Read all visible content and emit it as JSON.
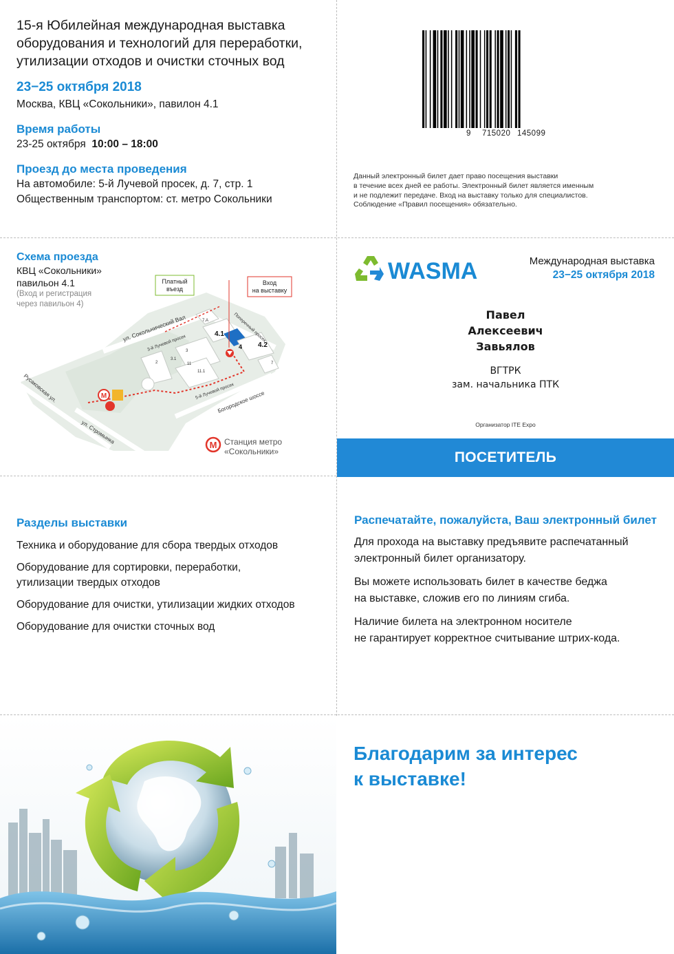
{
  "event": {
    "title_lines": [
      "15-я Юбилейная международная выставка",
      "оборудования и технологий для переработки,",
      "утилизации отходов и очистки сточных вод"
    ],
    "dates": "23−25 октября 2018",
    "venue": "Москва, КВЦ «Сокольники», павилон 4.1",
    "hours_heading": "Время работы",
    "hours_dates": "23-25 октября",
    "hours_time": "10:00 – 18:00",
    "travel_heading": "Проезд до места проведения",
    "by_car": "На автомобиле: 5-й Лучевой просек, д. 7, стр. 1",
    "by_transit": "Общественным транспортом: ст. метро Сокольники"
  },
  "barcode": {
    "digits": [
      "9",
      "715020",
      "145099"
    ]
  },
  "notice_lines": [
    "Данный электронный билет дает право посещения выставки",
    "в течение всех дней ее работы. Электронный билет является именным",
    "и не подлежит передаче. Вход на выставку только для специалистов.",
    "Соблюдение «Правил посещения» обязательно."
  ],
  "map": {
    "heading": "Схема проезда",
    "venue_line1": "КВЦ «Сокольники»",
    "venue_line2": "павильон 4.1",
    "note_line1": "(Вход и регистрация",
    "note_line2": "через павильон 4)",
    "paid_entry_line1": "Платный",
    "paid_entry_line2": "въезд",
    "entrance_line1": "Вход",
    "entrance_line2": "на выставку",
    "metro_line1": "Станция метро",
    "metro_line2": "«Сокольники»",
    "streets": {
      "sokolnichesky_val": "ул. Сокольнический Вал",
      "luchevoy3": "3-й Лучевой просек",
      "poperechny": "Поперечный просек",
      "luchevoy5": "5-й Лучевой просек",
      "bogorodskoe": "Богородское шоссе",
      "rusakovskaya": "Русаковская ул.",
      "stromynka": "ул. Стромынка"
    },
    "buildings": [
      "7.А",
      "4.1",
      "4",
      "4.2",
      "3",
      "3.1",
      "2",
      "11",
      "11.1",
      "7"
    ]
  },
  "badge": {
    "logo_text": "WASMA",
    "exhibition_label": "Международная выставка",
    "dates": "23−25 октября 2018",
    "first_name": "Павел",
    "patronymic": "Алексеевич",
    "last_name": "Завьялов",
    "company": "ВГТРК",
    "position": "зам. начальника ПТК",
    "organizer": "Организатор ITE Expo",
    "role": "ПОСЕТИТЕЛЬ"
  },
  "sections": {
    "heading": "Разделы выставки",
    "items": [
      [
        "Техника и оборудование для сбора твердых отходов"
      ],
      [
        "Оборудование для сортировки, переработки,",
        "утилизации твердых отходов"
      ],
      [
        "Оборудование для очистки, утилизации жидких отходов"
      ],
      [
        "Оборудование для очистки сточных вод"
      ]
    ]
  },
  "print_info": {
    "heading": "Распечатайте, пожалуйста, Ваш электронный билет",
    "paragraphs": [
      [
        "Для прохода на выставку предъявите распечатанный",
        "электронный билет организатору."
      ],
      [
        "Вы можете использовать билет в качестве беджа",
        "на выставке, сложив его по линиям сгиба."
      ],
      [
        "Наличие билета на электронном носителе",
        "не гарантирует корректное считывание штрих-кода."
      ]
    ]
  },
  "thanks": {
    "line1": "Благодарим за интерес",
    "line2": "к выставке!"
  },
  "colors": {
    "accent": "#1a8ad4",
    "bar": "#2189d6",
    "logo_green": "#7dbb2f",
    "metro_red": "#e2362b"
  }
}
